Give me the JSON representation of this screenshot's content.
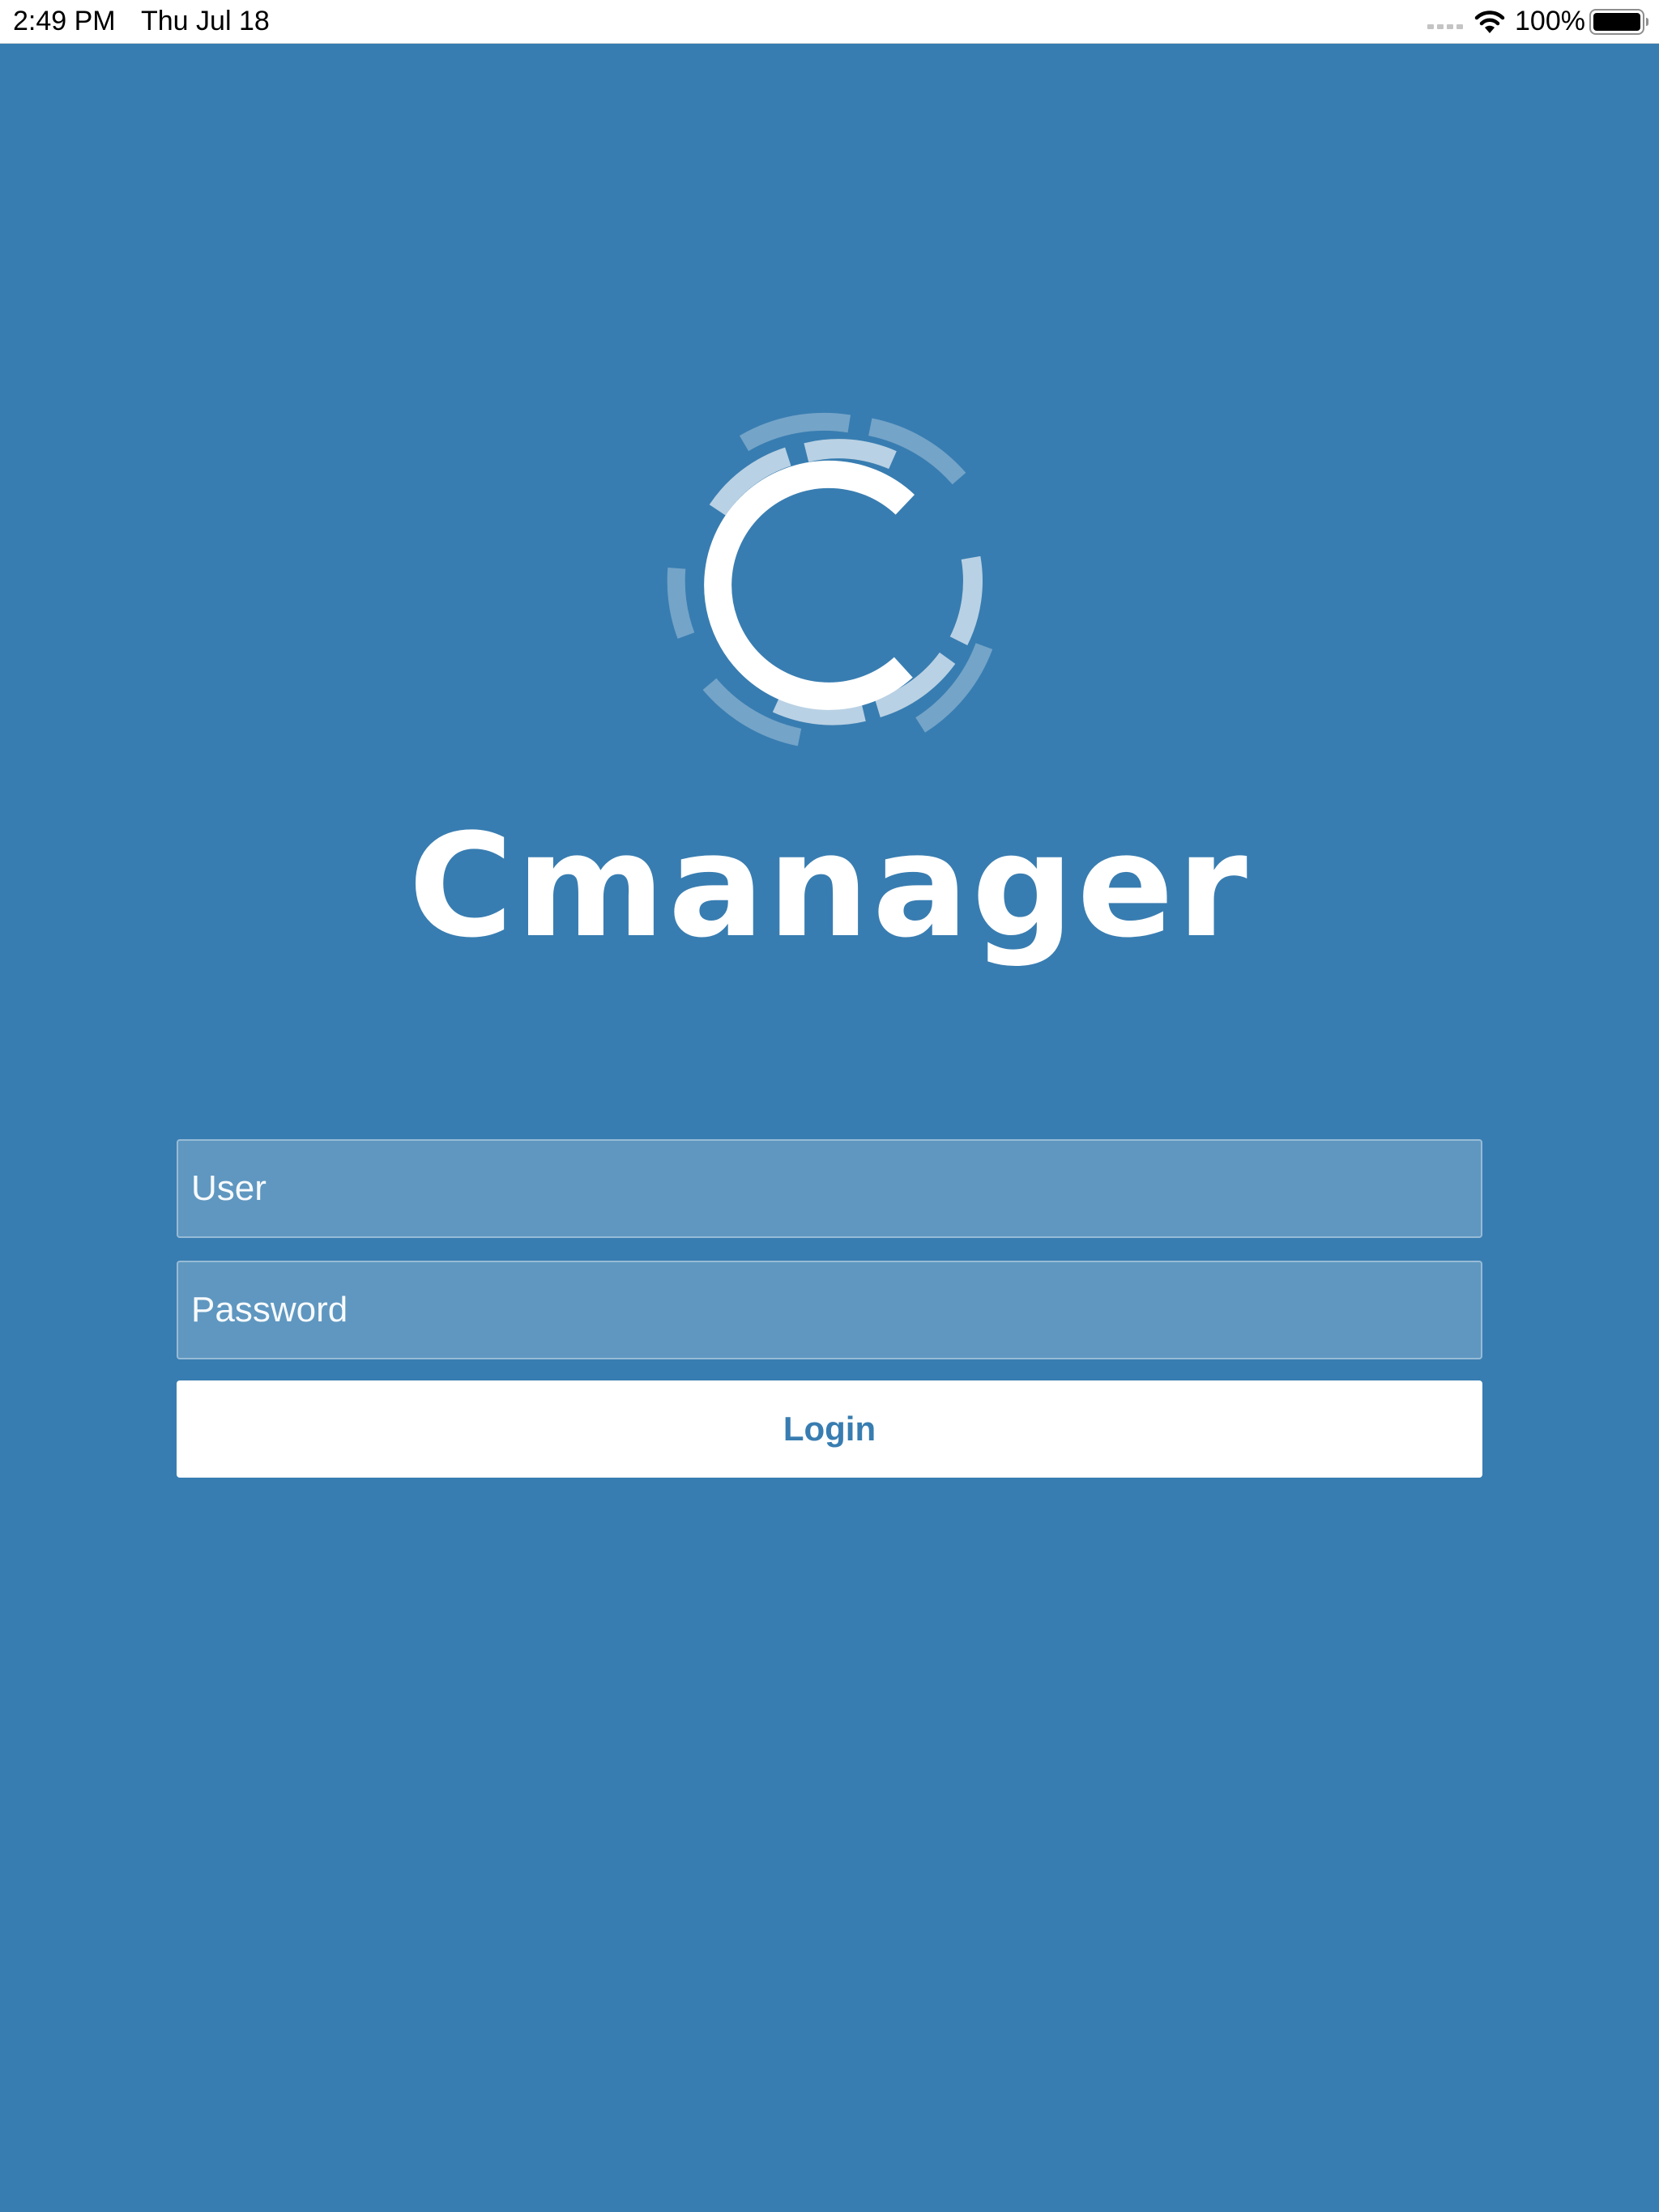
{
  "status_bar": {
    "time": "2:49 PM",
    "date": "Thu Jul 18",
    "battery_percent": "100%",
    "battery_level": 1.0,
    "icons": [
      "signal-icon",
      "wifi-icon",
      "battery-icon"
    ]
  },
  "app": {
    "name": "Cmanager",
    "logo_icon": "cmanager-logo-icon"
  },
  "login_form": {
    "user_placeholder": "User",
    "user_value": "",
    "password_placeholder": "Password",
    "password_value": "",
    "login_label": "Login"
  },
  "colors": {
    "background": "#387DB1",
    "field_background": "rgba(255,255,255,0.20)",
    "button_background": "#FFFFFF",
    "button_text": "#387DB1",
    "text": "#FFFFFF"
  }
}
